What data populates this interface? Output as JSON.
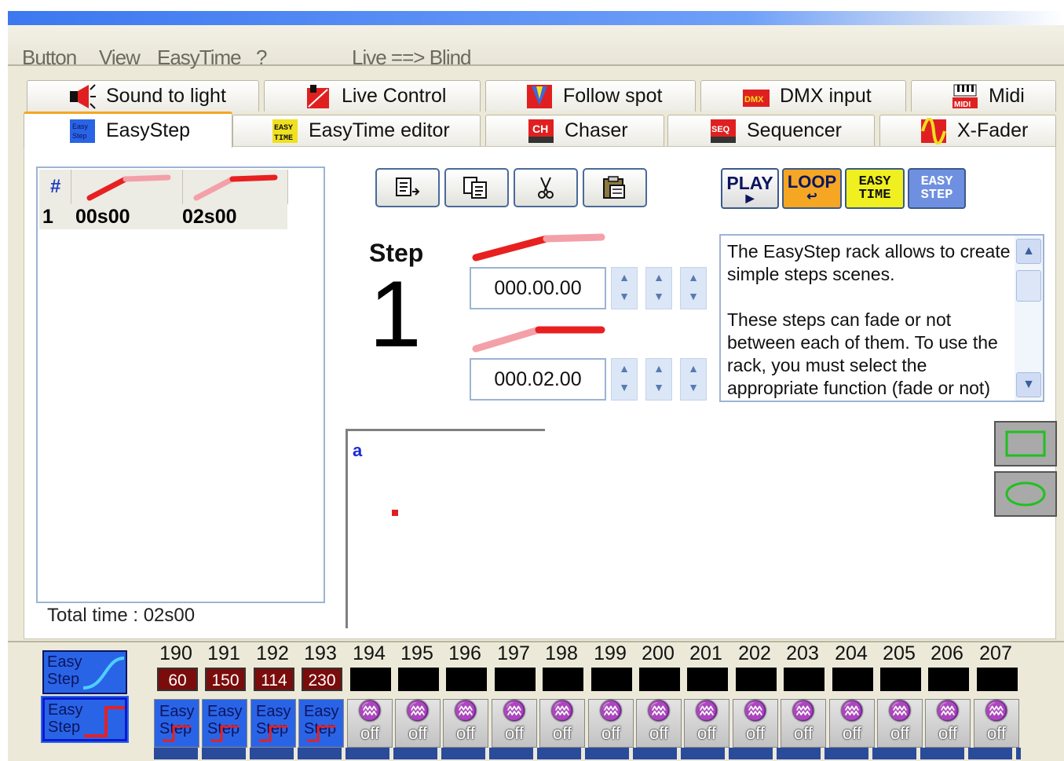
{
  "menu": {
    "items": [
      "Button",
      "View",
      "EasyTime",
      "?"
    ],
    "live_label": "Live ==> Blind"
  },
  "tabs_top": [
    {
      "label": "Sound to light",
      "icon": "speaker-icon"
    },
    {
      "label": "Live Control",
      "icon": "live-control-icon"
    },
    {
      "label": "Follow spot",
      "icon": "follow-spot-icon"
    },
    {
      "label": "DMX input",
      "icon": "dmx-input-icon"
    },
    {
      "label": "Midi",
      "icon": "midi-icon"
    }
  ],
  "tabs_bottom": [
    {
      "label": "EasyStep",
      "icon": "easystep-icon",
      "active": true
    },
    {
      "label": "EasyTime editor",
      "icon": "easytime-icon"
    },
    {
      "label": "Chaser",
      "icon": "chaser-icon"
    },
    {
      "label": "Sequencer",
      "icon": "sequencer-icon"
    },
    {
      "label": "X-Fader",
      "icon": "xfader-icon"
    }
  ],
  "step_list": {
    "header_hash": "#",
    "rows": [
      {
        "num": "1",
        "fade_in": "00s00",
        "fade_out": "02s00"
      }
    ],
    "total_label": "Total time : 02s00"
  },
  "toolbar": {
    "icons": [
      "new-step-icon",
      "copy-icon",
      "cut-icon",
      "paste-icon"
    ]
  },
  "mode_buttons": {
    "play": "PLAY",
    "loop": "LOOP",
    "easy_time": [
      "EASY",
      "TIME"
    ],
    "easy_step": [
      "EASY",
      "STEP"
    ]
  },
  "step_editor": {
    "label": "Step",
    "number": "1",
    "fade_in_time": "000.00.00",
    "fade_out_time": "000.02.00"
  },
  "help": {
    "text": "The EasyStep rack allows to create simple steps scenes.\n\nThese steps can fade or not between each of them. To use the rack, you must select the appropriate function (fade or not)"
  },
  "preview": {
    "label": "a"
  },
  "bottom_mode": {
    "line1": "Easy",
    "line2": "Step"
  },
  "channels": [
    {
      "num": "190",
      "value": "60",
      "type": "easy"
    },
    {
      "num": "191",
      "value": "150",
      "type": "easy"
    },
    {
      "num": "192",
      "value": "114",
      "type": "easy"
    },
    {
      "num": "193",
      "value": "230",
      "type": "easy"
    },
    {
      "num": "194",
      "value": "",
      "type": "off"
    },
    {
      "num": "195",
      "value": "",
      "type": "off"
    },
    {
      "num": "196",
      "value": "",
      "type": "off"
    },
    {
      "num": "197",
      "value": "",
      "type": "off"
    },
    {
      "num": "198",
      "value": "",
      "type": "off"
    },
    {
      "num": "199",
      "value": "",
      "type": "off"
    },
    {
      "num": "200",
      "value": "",
      "type": "off"
    },
    {
      "num": "201",
      "value": "",
      "type": "off"
    },
    {
      "num": "202",
      "value": "",
      "type": "off"
    },
    {
      "num": "203",
      "value": "",
      "type": "off"
    },
    {
      "num": "204",
      "value": "",
      "type": "off"
    },
    {
      "num": "205",
      "value": "",
      "type": "off"
    },
    {
      "num": "206",
      "value": "",
      "type": "off"
    },
    {
      "num": "207",
      "value": "",
      "type": "off"
    }
  ],
  "channel_labels": {
    "easy1": "Easy",
    "easy2": "Step",
    "off": "off"
  },
  "colors": {
    "accent_blue": "#2a64e6",
    "fade_red": "#e82020",
    "tab_highlight": "#f5a623"
  }
}
